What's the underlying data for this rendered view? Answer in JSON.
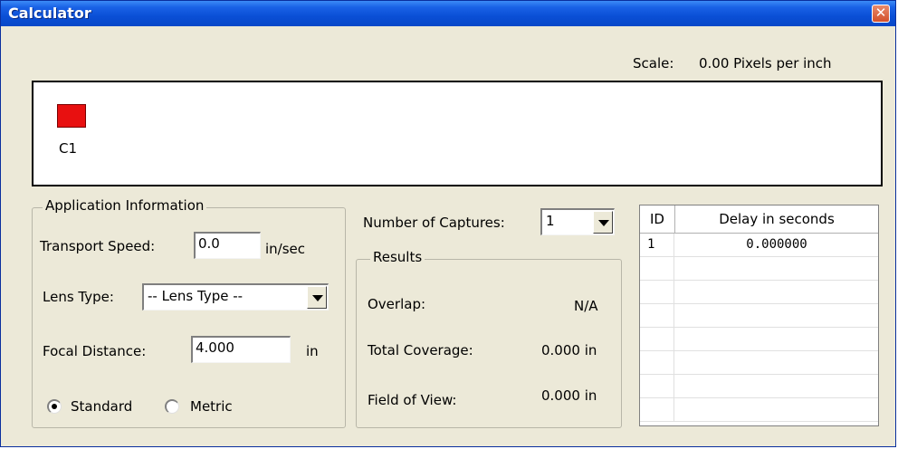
{
  "window": {
    "title": "Calculator",
    "close_glyph": "✕"
  },
  "scale": {
    "label": "Scale:",
    "value": "0.00 Pixels per inch"
  },
  "preview": {
    "camera_label": "C1",
    "camera_color": "#e81010"
  },
  "app_info": {
    "title": "Application Information",
    "transport_label": "Transport Speed:",
    "transport_value": "0.0",
    "transport_unit": "in/sec",
    "lens_label": "Lens Type:",
    "lens_value": "-- Lens Type --",
    "focal_label": "Focal Distance:",
    "focal_value": "4.000",
    "focal_unit": "in",
    "standard_label": "Standard",
    "metric_label": "Metric",
    "selected_units": "Standard"
  },
  "captures": {
    "label": "Number of Captures:",
    "value": "1"
  },
  "results": {
    "title": "Results",
    "overlap_label": "Overlap:",
    "overlap_value": "N/A",
    "coverage_label": "Total Coverage:",
    "coverage_value": "0.000 in",
    "fov_label": "Field of View:",
    "fov_value": "0.000 in"
  },
  "delay_table": {
    "col_id": "ID",
    "col_delay": "Delay in seconds",
    "rows": [
      {
        "id": "1",
        "delay": "0.000000"
      }
    ]
  }
}
